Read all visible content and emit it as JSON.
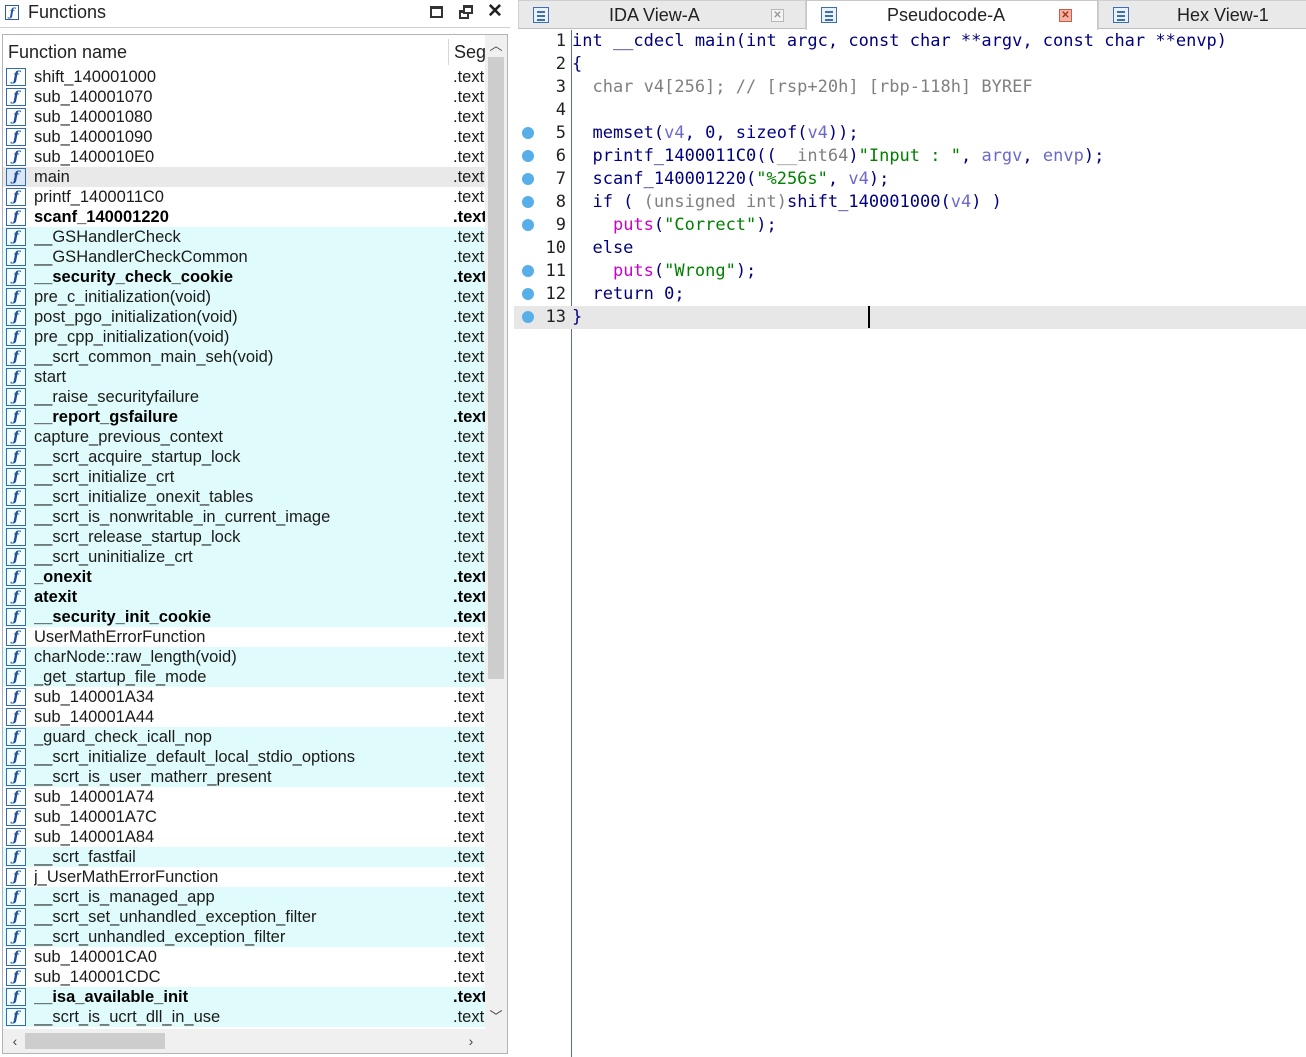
{
  "functions_panel": {
    "title": "Functions",
    "columns": {
      "name": "Function name",
      "segment": "Seg"
    },
    "rows": [
      {
        "name": "shift_140001000",
        "seg": ".text",
        "style": "normal"
      },
      {
        "name": "sub_140001070",
        "seg": ".text",
        "style": "normal"
      },
      {
        "name": "sub_140001080",
        "seg": ".text",
        "style": "normal"
      },
      {
        "name": "sub_140001090",
        "seg": ".text",
        "style": "normal"
      },
      {
        "name": "sub_1400010E0",
        "seg": ".text",
        "style": "normal"
      },
      {
        "name": "main",
        "seg": ".text",
        "style": "selected"
      },
      {
        "name": "printf_1400011C0",
        "seg": ".text",
        "style": "normal"
      },
      {
        "name": "scanf_140001220",
        "seg": ".text",
        "style": "bold"
      },
      {
        "name": "__GSHandlerCheck",
        "seg": ".text",
        "style": "cyan"
      },
      {
        "name": "__GSHandlerCheckCommon",
        "seg": ".text",
        "style": "cyan"
      },
      {
        "name": "__security_check_cookie",
        "seg": ".text",
        "style": "cyan-bold"
      },
      {
        "name": "pre_c_initialization(void)",
        "seg": ".text",
        "style": "cyan"
      },
      {
        "name": "post_pgo_initialization(void)",
        "seg": ".text",
        "style": "cyan"
      },
      {
        "name": "pre_cpp_initialization(void)",
        "seg": ".text",
        "style": "cyan"
      },
      {
        "name": "__scrt_common_main_seh(void)",
        "seg": ".text",
        "style": "cyan"
      },
      {
        "name": "start",
        "seg": ".text",
        "style": "cyan"
      },
      {
        "name": "__raise_securityfailure",
        "seg": ".text",
        "style": "cyan"
      },
      {
        "name": "__report_gsfailure",
        "seg": ".text",
        "style": "cyan-bold"
      },
      {
        "name": "capture_previous_context",
        "seg": ".text",
        "style": "cyan"
      },
      {
        "name": "__scrt_acquire_startup_lock",
        "seg": ".text",
        "style": "cyan"
      },
      {
        "name": "__scrt_initialize_crt",
        "seg": ".text",
        "style": "cyan"
      },
      {
        "name": "__scrt_initialize_onexit_tables",
        "seg": ".text",
        "style": "cyan"
      },
      {
        "name": "__scrt_is_nonwritable_in_current_image",
        "seg": ".text",
        "style": "cyan"
      },
      {
        "name": "__scrt_release_startup_lock",
        "seg": ".text",
        "style": "cyan"
      },
      {
        "name": "__scrt_uninitialize_crt",
        "seg": ".text",
        "style": "cyan"
      },
      {
        "name": "_onexit",
        "seg": ".text",
        "style": "cyan-bold"
      },
      {
        "name": "atexit",
        "seg": ".text",
        "style": "cyan-bold"
      },
      {
        "name": "__security_init_cookie",
        "seg": ".text",
        "style": "cyan-bold"
      },
      {
        "name": "UserMathErrorFunction",
        "seg": ".text",
        "style": "normal"
      },
      {
        "name": "charNode::raw_length(void)",
        "seg": ".text",
        "style": "cyan"
      },
      {
        "name": "_get_startup_file_mode",
        "seg": ".text",
        "style": "cyan"
      },
      {
        "name": "sub_140001A34",
        "seg": ".text",
        "style": "normal"
      },
      {
        "name": "sub_140001A44",
        "seg": ".text",
        "style": "normal"
      },
      {
        "name": "_guard_check_icall_nop",
        "seg": ".text",
        "style": "cyan"
      },
      {
        "name": "__scrt_initialize_default_local_stdio_options",
        "seg": ".text",
        "style": "cyan"
      },
      {
        "name": "__scrt_is_user_matherr_present",
        "seg": ".text",
        "style": "cyan"
      },
      {
        "name": "sub_140001A74",
        "seg": ".text",
        "style": "normal"
      },
      {
        "name": "sub_140001A7C",
        "seg": ".text",
        "style": "normal"
      },
      {
        "name": "sub_140001A84",
        "seg": ".text",
        "style": "normal"
      },
      {
        "name": "__scrt_fastfail",
        "seg": ".text",
        "style": "cyan"
      },
      {
        "name": "j_UserMathErrorFunction",
        "seg": ".text",
        "style": "normal"
      },
      {
        "name": "__scrt_is_managed_app",
        "seg": ".text",
        "style": "cyan"
      },
      {
        "name": "__scrt_set_unhandled_exception_filter",
        "seg": ".text",
        "style": "cyan"
      },
      {
        "name": "__scrt_unhandled_exception_filter",
        "seg": ".text",
        "style": "cyan"
      },
      {
        "name": "sub_140001CA0",
        "seg": ".text",
        "style": "normal"
      },
      {
        "name": "sub_140001CDC",
        "seg": ".text",
        "style": "normal"
      },
      {
        "name": "__isa_available_init",
        "seg": ".text",
        "style": "cyan-bold"
      },
      {
        "name": "__scrt_is_ucrt_dll_in_use",
        "seg": ".text",
        "style": "cyan"
      }
    ]
  },
  "tabs": [
    {
      "label": "IDA View-A",
      "active": false
    },
    {
      "label": "Pseudocode-A",
      "active": true
    },
    {
      "label": "Hex View-1",
      "active": false
    }
  ],
  "pseudocode": {
    "lines": [
      {
        "no": "1",
        "dot": false,
        "segs": [
          [
            "k",
            "int __cdecl main(int argc, const char **argv, const char **envp)"
          ]
        ]
      },
      {
        "no": "2",
        "dot": false,
        "segs": [
          [
            "k",
            "{"
          ]
        ]
      },
      {
        "no": "3",
        "dot": false,
        "segs": [
          [
            "g",
            "  char v4[256]; // [rsp+20h] [rbp-118h] BYREF"
          ]
        ]
      },
      {
        "no": "4",
        "dot": false,
        "segs": []
      },
      {
        "no": "5",
        "dot": true,
        "segs": [
          [
            "k",
            "  memset("
          ],
          [
            "b",
            "v4"
          ],
          [
            "k",
            ", 0, sizeof("
          ],
          [
            "b",
            "v4"
          ],
          [
            "k",
            "));"
          ]
        ]
      },
      {
        "no": "6",
        "dot": true,
        "segs": [
          [
            "k",
            "  printf_1400011C0(("
          ],
          [
            "g",
            "__int64"
          ],
          [
            "k",
            ")"
          ],
          [
            "s",
            "\"Input : \""
          ],
          [
            "k",
            ", "
          ],
          [
            "b",
            "argv"
          ],
          [
            "k",
            ", "
          ],
          [
            "b",
            "envp"
          ],
          [
            "k",
            ");"
          ]
        ]
      },
      {
        "no": "7",
        "dot": true,
        "segs": [
          [
            "k",
            "  scanf_140001220("
          ],
          [
            "s",
            "\"%256s\""
          ],
          [
            "k",
            ", "
          ],
          [
            "b",
            "v4"
          ],
          [
            "k",
            ");"
          ]
        ]
      },
      {
        "no": "8",
        "dot": true,
        "segs": [
          [
            "k",
            "  if ( "
          ],
          [
            "g",
            "(unsigned int)"
          ],
          [
            "k",
            "shift_140001000("
          ],
          [
            "b",
            "v4"
          ],
          [
            "k",
            ") )"
          ]
        ]
      },
      {
        "no": "9",
        "dot": true,
        "segs": [
          [
            "k",
            "    "
          ],
          [
            "m",
            "puts"
          ],
          [
            "k",
            "("
          ],
          [
            "s",
            "\"Correct\""
          ],
          [
            "k",
            ");"
          ]
        ]
      },
      {
        "no": "10",
        "dot": false,
        "segs": [
          [
            "k",
            "  else"
          ]
        ]
      },
      {
        "no": "11",
        "dot": true,
        "segs": [
          [
            "k",
            "    "
          ],
          [
            "m",
            "puts"
          ],
          [
            "k",
            "("
          ],
          [
            "s",
            "\"Wrong\""
          ],
          [
            "k",
            ");"
          ]
        ]
      },
      {
        "no": "12",
        "dot": true,
        "segs": [
          [
            "k",
            "  return 0;"
          ]
        ]
      },
      {
        "no": "13",
        "dot": true,
        "segs": [
          [
            "k",
            "}"
          ]
        ],
        "current": true
      }
    ]
  },
  "colors": {
    "selected_row": "#e9e9e9",
    "library_row": "#e0fbfb",
    "dot": "#58aee8",
    "string": "#008000",
    "keyword": "#000080"
  }
}
